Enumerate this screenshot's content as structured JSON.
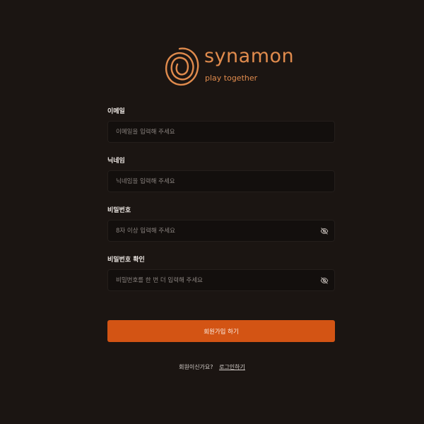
{
  "brand": {
    "name": "synamon",
    "tagline": "play together",
    "color": "#e08b4d"
  },
  "form": {
    "email": {
      "label": "이메일",
      "placeholder": "이메일을 입력해 주세요",
      "value": ""
    },
    "nickname": {
      "label": "닉네임",
      "placeholder": "닉네임을 입력해 주세요",
      "value": ""
    },
    "password": {
      "label": "비밀번호",
      "placeholder": "8자 이상 입력해 주세요",
      "value": "",
      "toggle_icon": "eye-icon"
    },
    "password_confirm": {
      "label": "비밀번호 확인",
      "placeholder": "비밀번호를 한 번 더 입력해 주세요",
      "value": "",
      "toggle_icon": "eye-icon"
    },
    "submit_label": "회원가입 하기"
  },
  "footer": {
    "question": "회원이신가요?",
    "login_link": "로그인하기"
  },
  "colors": {
    "background": "#1b1512",
    "input_background": "#130f0d",
    "primary_button": "#d35414"
  }
}
